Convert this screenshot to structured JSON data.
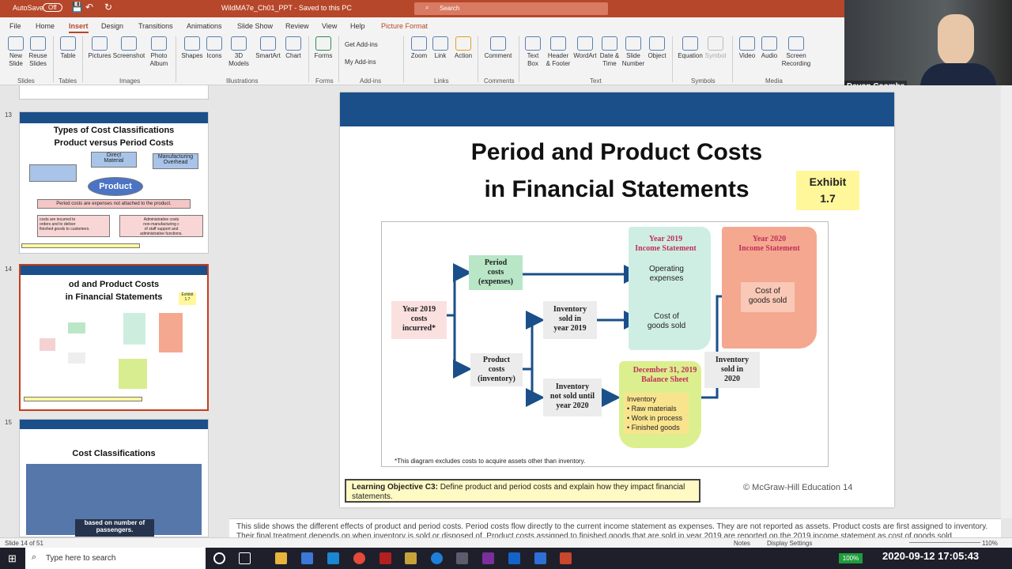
{
  "titlebar": {
    "autosave": "AutoSave",
    "autosave_state": "Off",
    "doc": "WildMA7e_Ch01_PPT - Saved to this PC",
    "search": "Search"
  },
  "tabs": [
    "File",
    "Home",
    "Insert",
    "Design",
    "Transitions",
    "Animations",
    "Slide Show",
    "Review",
    "View",
    "Help",
    "Picture Format"
  ],
  "active_tab": "Insert",
  "ribbon": {
    "buttons": [
      {
        "label": "New\nSlide"
      },
      {
        "label": "Reuse\nSlides"
      },
      {
        "label": "Table"
      },
      {
        "label": "Pictures"
      },
      {
        "label": "Screenshot"
      },
      {
        "label": "Photo\nAlbum"
      },
      {
        "label": "Shapes"
      },
      {
        "label": "Icons"
      },
      {
        "label": "3D\nModels"
      },
      {
        "label": "SmartArt"
      },
      {
        "label": "Chart"
      },
      {
        "label": "Forms"
      },
      {
        "label": "Zoom"
      },
      {
        "label": "Link"
      },
      {
        "label": "Action"
      },
      {
        "label": "Comment"
      },
      {
        "label": "Text\nBox"
      },
      {
        "label": "Header\n& Footer"
      },
      {
        "label": "WordArt"
      },
      {
        "label": "Date &\nTime"
      },
      {
        "label": "Slide\nNumber"
      },
      {
        "label": "Object"
      },
      {
        "label": "Equation"
      },
      {
        "label": "Symbol"
      },
      {
        "label": "Video"
      },
      {
        "label": "Audio"
      },
      {
        "label": "Screen\nRecording"
      }
    ],
    "addins": [
      "Get Add-ins",
      "My Add-ins"
    ],
    "groups": [
      "Slides",
      "Tables",
      "Images",
      "Illustrations",
      "Forms",
      "Add-ins",
      "Links",
      "Comments",
      "Text",
      "Symbols",
      "Media"
    ]
  },
  "webcam": {
    "name": "Devon Coombs"
  },
  "thumbnails": [
    {
      "num": "13",
      "title": "Types of Cost Classifications\nProduct versus Period Costs",
      "items": [
        "Direct\nMaterial",
        "Manufacturing\nOverhead",
        "Product",
        "Period costs are expenses not attached to the product.",
        "costs are incurred to\norders and to deliver\nfinished goods to customers.",
        "Administrative costs\nnon-manufacturing c\nof staff support and\nadministrative functions."
      ]
    },
    {
      "num": "14",
      "title": "od and Product Costs\nin Financial Statements",
      "exhibit": "Exhibit\n1.7"
    },
    {
      "num": "15",
      "title": "Cost Classifications",
      "items": [
        "based on number of\npassengers."
      ]
    }
  ],
  "slide": {
    "title": "Period and Product Costs\nin Financial Statements",
    "exhibit": "Exhibit\n1.7",
    "diagram": {
      "year2019_costs": "Year 2019\ncosts\nincurred*",
      "period_costs": "Period\ncosts\n(expenses)",
      "product_costs": "Product\ncosts\n(inventory)",
      "inv_sold_2019": "Inventory\nsold in\nyear 2019",
      "inv_not_sold": "Inventory\nnot sold until\nyear 2020",
      "is2019_title": "Year 2019\nIncome Statement",
      "op_exp": "Operating\nexpenses",
      "cogs2019": "Cost of\ngoods sold",
      "is2020_title": "Year 2020\nIncome Statement",
      "cogs2020": "Cost of\ngoods sold",
      "bs_title": "December 31, 2019\nBalance Sheet",
      "bs_items": "Inventory\n• Raw materials\n• Work in process\n• Finished goods",
      "inv_sold_2020": "Inventory\nsold in\n2020",
      "footnote": "*This diagram excludes costs to acquire assets other than inventory."
    },
    "learning_objective_label": "Learning Objective C3:",
    "learning_objective": " Define product and period costs and explain how they impact financial statements.",
    "copyright": "© McGraw-Hill Education 14"
  },
  "notes": "This slide shows the different effects of product and period costs. Period costs flow directly to the current income statement as expenses. They are not reported as assets. Product costs are first assigned to inventory. Their final treatment depends on when inventory is sold or disposed of. Product costs assigned to finished goods that are sold in year 2019 are reported on the 2019 income statement as cost of goods sold.",
  "status": {
    "slide": "Slide 14 of 51",
    "notes": "Notes",
    "display": "Display Settings",
    "zoom": "110%"
  },
  "taskbar": {
    "search": "Type here to search",
    "battery": "100%",
    "clock": "2020-09-12  17:05:43"
  }
}
